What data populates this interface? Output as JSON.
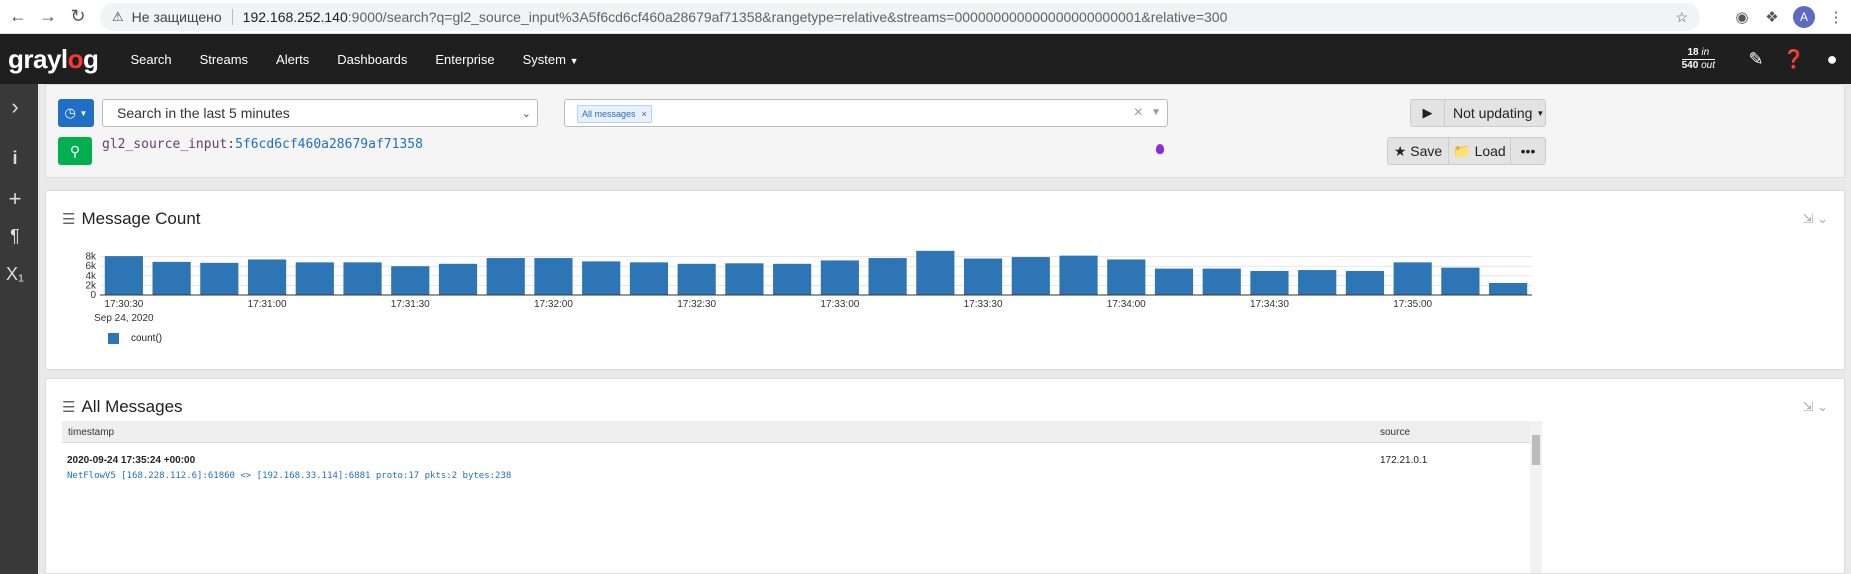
{
  "browser": {
    "security": "Не защищено",
    "host": "192.168.252.140",
    "path": ":9000/search?q=gl2_source_input%3A5f6cd6cf460a28679af71358&rangetype=relative&streams=000000000000000000000001&relative=300",
    "avatar": "A"
  },
  "nav": {
    "logo_a": "gray",
    "logo_b": "l",
    "logo_c": "o",
    "logo_d": "g",
    "items": [
      "Search",
      "Streams",
      "Alerts",
      "Dashboards",
      "Enterprise",
      "System"
    ],
    "throughput_in": "18",
    "throughput_in_label": "in",
    "throughput_out": "540",
    "throughput_out_label": "out"
  },
  "query": {
    "time_range": "Search in the last 5 minutes",
    "stream_tag": "All messages",
    "query_field": "gl2_source_input:",
    "query_value": "5f6cd6cf460a28679af71358",
    "updating": "Not updating",
    "save": "Save",
    "load": "Load"
  },
  "count_widget": {
    "title": "Message Count",
    "legend": "count()"
  },
  "chart_data": {
    "type": "bar",
    "x": [
      "17:30:30",
      "17:30:40",
      "17:30:50",
      "17:31:00",
      "17:31:10",
      "17:31:20",
      "17:31:30",
      "17:31:40",
      "17:31:50",
      "17:32:00",
      "17:32:10",
      "17:32:20",
      "17:32:30",
      "17:32:40",
      "17:32:50",
      "17:33:00",
      "17:33:10",
      "17:33:20",
      "17:33:30",
      "17:33:40",
      "17:33:50",
      "17:34:00",
      "17:34:10",
      "17:34:20",
      "17:34:30",
      "17:34:40",
      "17:34:50",
      "17:35:00",
      "17:35:10",
      "17:35:20"
    ],
    "values": [
      8100,
      6900,
      6700,
      7400,
      6800,
      6800,
      6000,
      6500,
      7700,
      7700,
      7000,
      6800,
      6500,
      6600,
      6500,
      7200,
      7700,
      9200,
      7600,
      7900,
      8200,
      7400,
      5500,
      5500,
      5000,
      5200,
      5000,
      6800,
      5700,
      2500
    ],
    "ylim": [
      0,
      10000
    ],
    "yticks": [
      "8k",
      "6k",
      "4k",
      "2k",
      "0"
    ],
    "xticks": [
      "17:30:30",
      "17:31:00",
      "17:31:30",
      "17:32:00",
      "17:32:30",
      "17:33:00",
      "17:33:30",
      "17:34:00",
      "17:34:30",
      "17:35:00"
    ],
    "date_label": "Sep 24, 2020",
    "series": [
      {
        "name": "count()"
      }
    ],
    "color": "#2e75b5"
  },
  "messages_widget": {
    "title": "All Messages",
    "col_timestamp": "timestamp",
    "col_source": "source",
    "row1_timestamp": "2020-09-24 17:35:24 +00:00",
    "row1_source": "172.21.0.1",
    "row1_message": "NetFlowV5 [168.228.112.6]:61860 <> [192.168.33.114]:6881 proto:17 pkts:2 bytes:238"
  }
}
